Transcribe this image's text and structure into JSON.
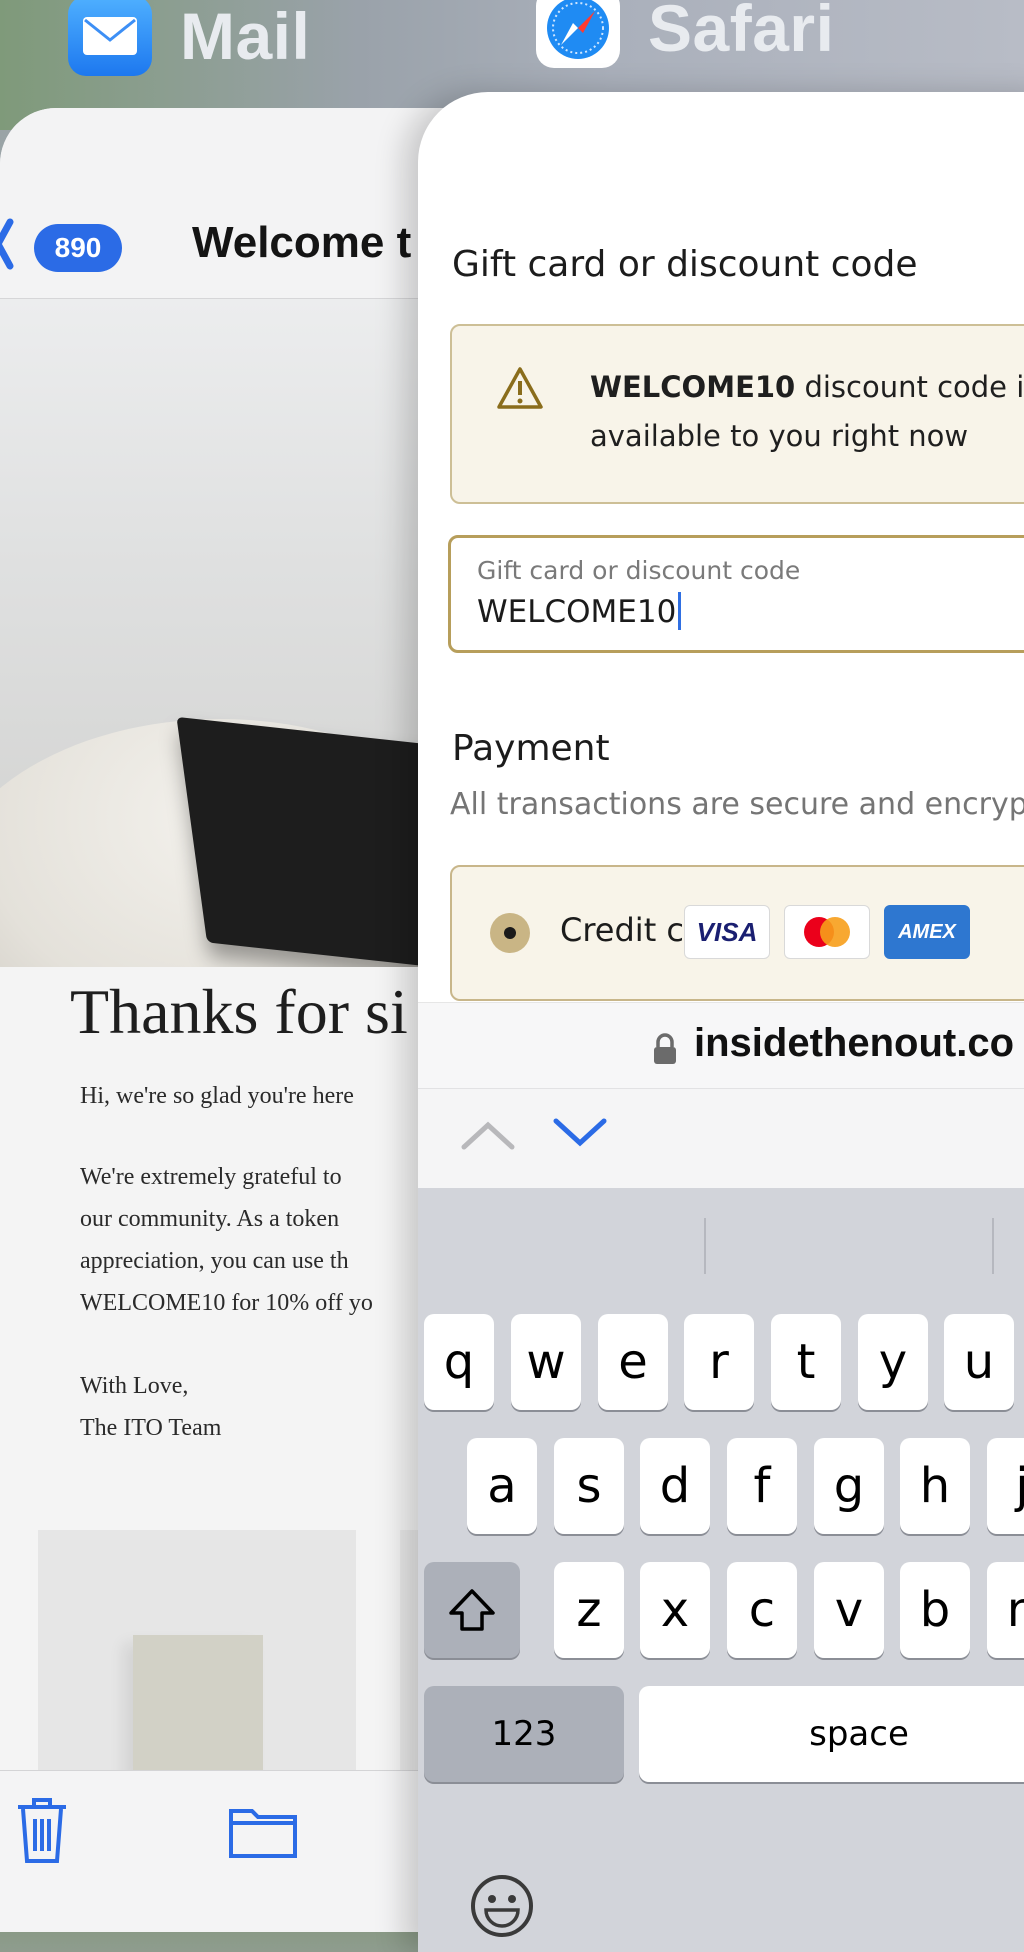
{
  "switcher": {
    "mail_app": {
      "name": "Mail",
      "icon": "envelope-icon"
    },
    "safari_app": {
      "name": "Safari",
      "icon": "compass-icon"
    }
  },
  "mail": {
    "unread_count": "890",
    "subject": "Welcome t",
    "headline": "Thanks for si",
    "body_lines": [
      "Hi, we're so glad you're here",
      "We're extremely grateful to",
      "our community. As a token",
      "appreciation, you can use th",
      "WELCOME10 for 10% off yo"
    ],
    "signoff": [
      "With Love,",
      "The ITO Team"
    ],
    "toolbar": {
      "trash": "trash-icon",
      "folder": "folder-icon"
    }
  },
  "safari": {
    "section_title": "Gift card or discount code",
    "notice": {
      "code": "WELCOME10",
      "text_1": " discount code is",
      "text_2": "available to you right now"
    },
    "field": {
      "label": "Gift card or discount code",
      "value": "WELCOME10"
    },
    "payment": {
      "title": "Payment",
      "note": "All transactions are secure and encryp"
    },
    "pay_option": {
      "label": "Credit card",
      "logos": [
        "VISA",
        "AMEX"
      ]
    },
    "url": "insidethenout.co",
    "keyboard": {
      "row1": [
        "q",
        "w",
        "e",
        "r",
        "t",
        "y",
        "u"
      ],
      "row2": [
        "a",
        "s",
        "d",
        "f",
        "g",
        "h",
        "j"
      ],
      "row3": [
        "z",
        "x",
        "c",
        "v",
        "b",
        "n"
      ],
      "numbers": "123",
      "space": "space"
    }
  },
  "colors": {
    "accent": "#2b6be6",
    "field_border": "#b79e5b",
    "notice_bg": "#f8f4e9"
  }
}
